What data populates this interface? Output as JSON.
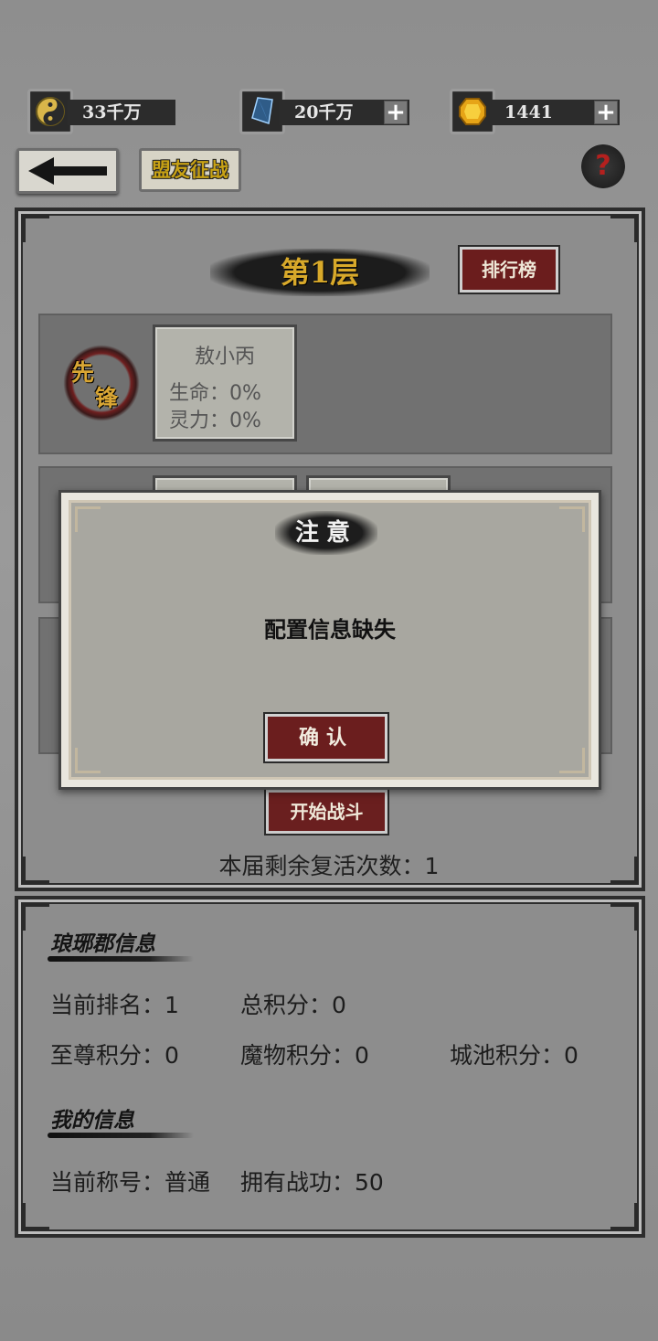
{
  "resources": [
    {
      "icon": "yin-yang-icon",
      "value": "33千万",
      "has_plus": false
    },
    {
      "icon": "blue-crystal-icon",
      "value": "20千万",
      "has_plus": true
    },
    {
      "icon": "gold-gem-icon",
      "value": "1441",
      "has_plus": true
    }
  ],
  "nav": {
    "back_icon": "left-arrow-icon",
    "league_label": "盟友征战",
    "help_label": "?"
  },
  "floor": {
    "title": "第1层",
    "ranking_label": "排行榜"
  },
  "vanguard": {
    "seal_top": "先",
    "seal_bottom": "锋",
    "name": "敖小丙",
    "hp": "生命：0%",
    "sp": "灵力：0%"
  },
  "battle": {
    "start_label": "开始战斗",
    "revive_text": "本届剩余复活次数：1"
  },
  "county_info": {
    "title": "琅琊郡信息",
    "rank": "当前排名：1",
    "total": "总积分：0",
    "supreme": "至尊积分：0",
    "monster": "魔物积分：0",
    "city": "城池积分：0"
  },
  "my_info": {
    "title": "我的信息",
    "title_rank": "当前称号：普通",
    "merit": "拥有战功：50"
  },
  "modal": {
    "title": "注意",
    "message": "配置信息缺失",
    "confirm_label": "确认"
  }
}
